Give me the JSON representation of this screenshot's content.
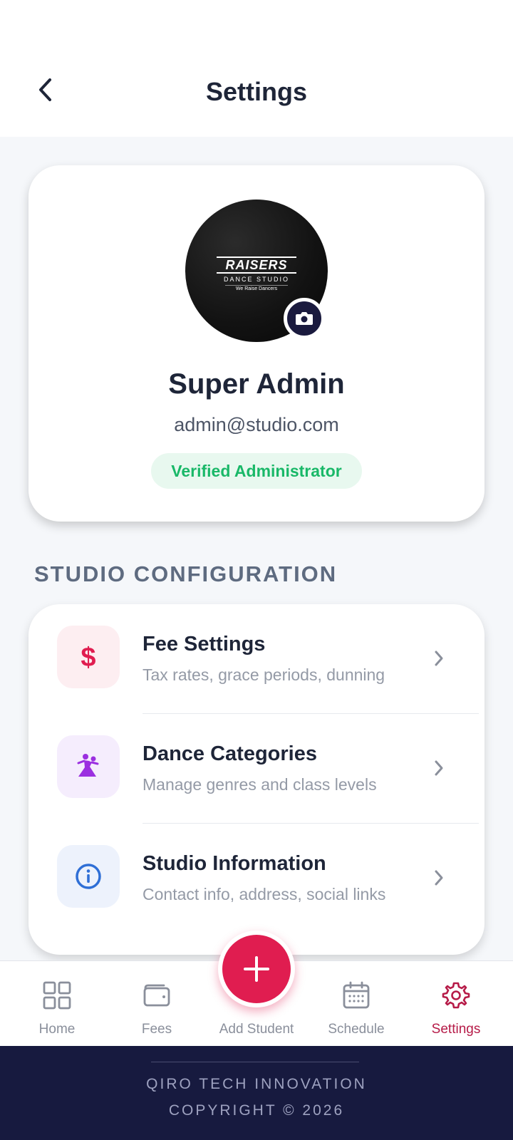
{
  "header": {
    "title": "Settings",
    "back_icon": "chevron-left-icon"
  },
  "profile": {
    "logo": {
      "brand": "RAISERS",
      "subtitle": "DANCE STUDIO",
      "tagline": "We Raise Dancers"
    },
    "camera_icon": "camera-icon",
    "name": "Super Admin",
    "email": "admin@studio.com",
    "badge": "Verified Administrator",
    "badge_colors": {
      "background": "#e8f8ef",
      "text": "#19b868"
    }
  },
  "section": {
    "title": "STUDIO CONFIGURATION"
  },
  "config_items": [
    {
      "title": "Fee Settings",
      "subtitle": "Tax rates, grace periods, dunning",
      "icon": "dollar-icon",
      "icon_color": "#e01d50",
      "icon_bg": "#fdeef1"
    },
    {
      "title": "Dance Categories",
      "subtitle": "Manage genres and class levels",
      "icon": "dancer-icon",
      "icon_color": "#9b2fe0",
      "icon_bg": "#f5edfd"
    },
    {
      "title": "Studio Information",
      "subtitle": "Contact info, address, social links",
      "icon": "info-icon",
      "icon_color": "#2f6fd6",
      "icon_bg": "#edf2fc"
    }
  ],
  "bottom_nav": {
    "items": [
      {
        "label": "Home",
        "icon": "grid-icon",
        "active": false
      },
      {
        "label": "Fees",
        "icon": "wallet-icon",
        "active": false
      },
      {
        "label": "Add Student",
        "icon": "plus-icon",
        "active": false
      },
      {
        "label": "Schedule",
        "icon": "calendar-icon",
        "active": false
      },
      {
        "label": "Settings",
        "icon": "gear-icon",
        "active": true
      }
    ],
    "active_color": "#b61b48",
    "inactive_color": "#8a8f9b",
    "fab_color": "#e01d50"
  },
  "footer": {
    "company": "QIRO TECH INNOVATION",
    "copyright": "COPYRIGHT © 2026"
  }
}
